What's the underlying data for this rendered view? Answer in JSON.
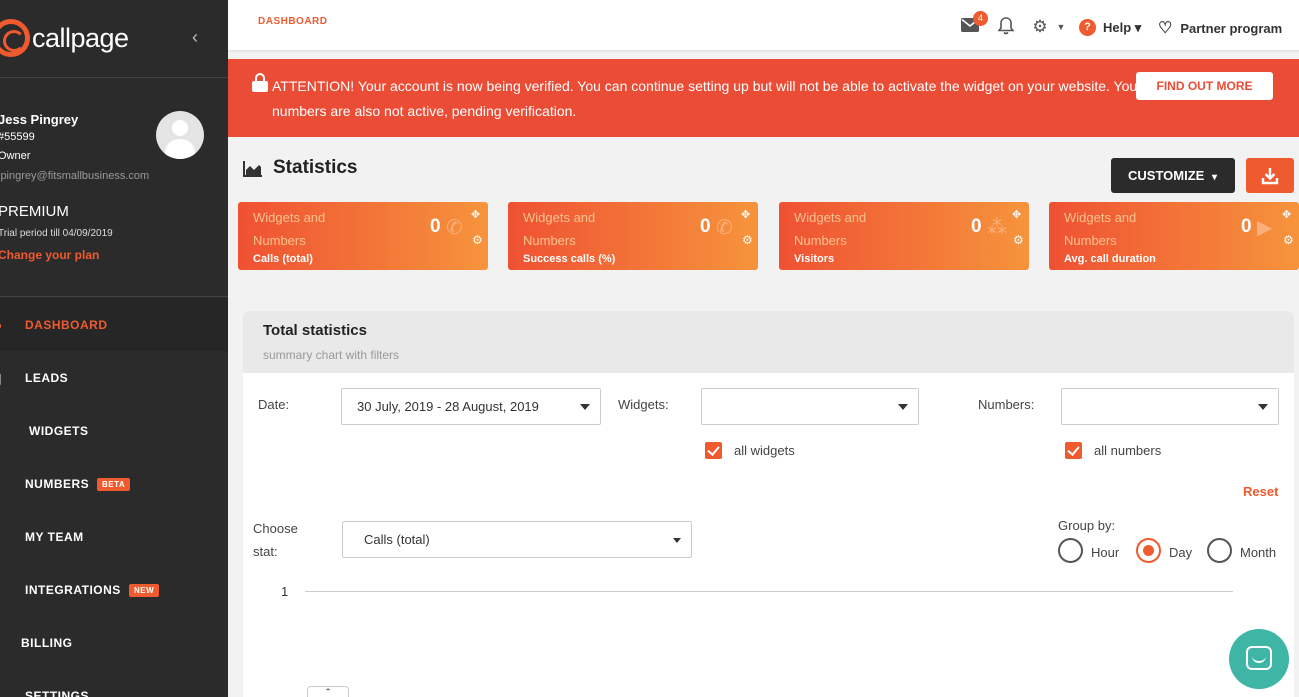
{
  "brand": {
    "name": "callpage",
    "accent": "#ef5a2f"
  },
  "user": {
    "name": "Jess Pingrey",
    "id": "#55599",
    "role": "Owner",
    "email": "jpingrey@fitsmallbusiness.com"
  },
  "plan": {
    "name": "PREMIUM",
    "trial": "Trial period till 04/09/2019",
    "change_label": "Change your plan"
  },
  "nav": {
    "items": [
      {
        "label": "DASHBOARD",
        "icon": "dashboard-icon",
        "active": true
      },
      {
        "label": "LEADS",
        "icon": "leads-icon"
      },
      {
        "label": "WIDGETS",
        "icon": "code-icon"
      },
      {
        "label": "NUMBERS",
        "icon": "phone-icon",
        "badge": "BETA"
      },
      {
        "label": "MY TEAM",
        "icon": "team-icon"
      },
      {
        "label": "INTEGRATIONS",
        "icon": "integrations-icon",
        "badge": "NEW"
      },
      {
        "label": "BILLING",
        "icon": "billing-icon"
      },
      {
        "label": "SETTINGS",
        "icon": "settings-icon"
      }
    ]
  },
  "topbar": {
    "breadcrumb": "DASHBOARD",
    "mail_count": "4",
    "help_label": "Help",
    "partner_label": "Partner program"
  },
  "alert": {
    "text": "ATTENTION! Your account is now being verified. You can continue setting up but will not be able to activate the widget on your website. Your numbers are also not active, pending verification.",
    "button_label": "FIND OUT MORE",
    "color": "#eb4c35"
  },
  "statistics": {
    "title": "Statistics",
    "customize_label": "CUSTOMIZE",
    "cards": [
      {
        "title": "Widgets and Numbers",
        "label": "Calls (total)",
        "value": "0",
        "icon": "phone-ring-icon"
      },
      {
        "title": "Widgets and Numbers",
        "label": "Success calls (%)",
        "value": "0",
        "icon": "phone-icon"
      },
      {
        "title": "Widgets and Numbers",
        "label": "Visitors",
        "value": "0",
        "icon": "share-icon"
      },
      {
        "title": "Widgets and Numbers",
        "label": "Avg. call duration",
        "value": "0",
        "icon": "play-icon"
      }
    ]
  },
  "total": {
    "title": "Total statistics",
    "subtitle": "summary chart with filters",
    "date_label": "Date:",
    "date_value": "30 July, 2019 - 28 August, 2019",
    "widgets_label": "Widgets:",
    "widgets_value": "",
    "all_widgets_label": "all widgets",
    "all_widgets_checked": true,
    "numbers_label": "Numbers:",
    "numbers_value": "",
    "all_numbers_label": "all numbers",
    "all_numbers_checked": true,
    "reset_label": "Reset",
    "choose_stat_label": "Choose stat:",
    "stat_value": "Calls (total)",
    "group_by_label": "Group by:",
    "group_options": [
      "Hour",
      "Day",
      "Month"
    ],
    "group_selected": "Day",
    "chart_tick": "1"
  }
}
